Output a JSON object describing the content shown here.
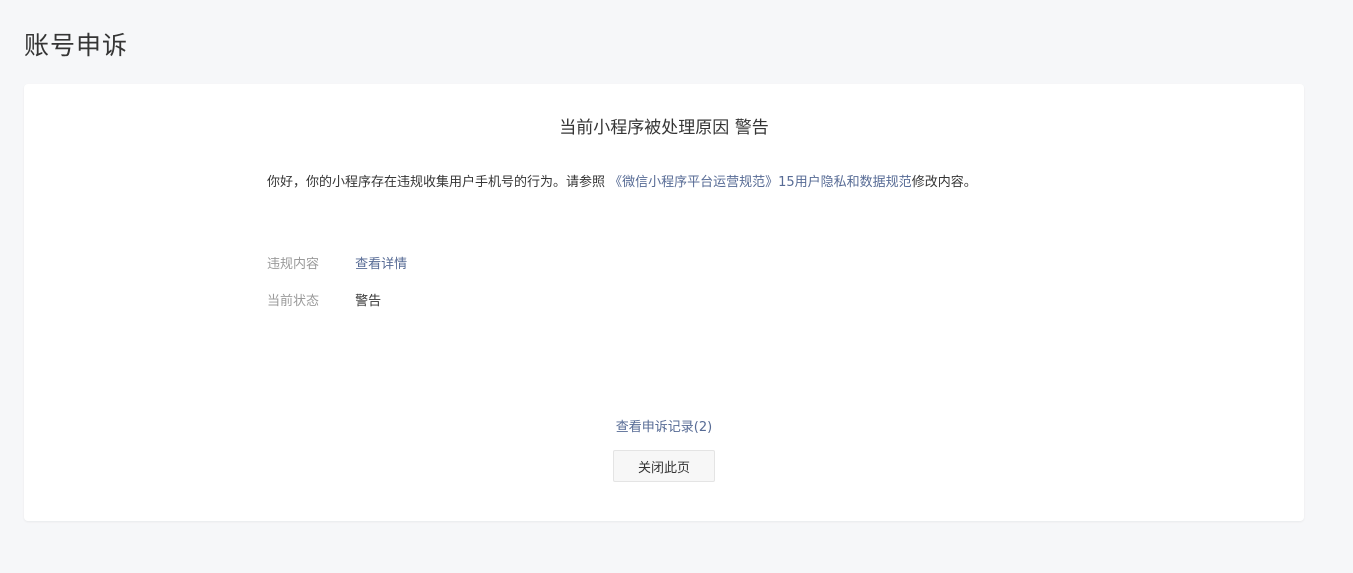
{
  "page": {
    "title": "账号申诉"
  },
  "card": {
    "reason_title": "当前小程序被处理原因 警告",
    "notice": {
      "text_before": "你好，你的小程序存在违规收集用户手机号的行为。请参照 ",
      "link_text": "《微信小程序平台运营规范》15用户隐私和数据规范",
      "text_after": "修改内容。"
    },
    "info": [
      {
        "label": "违规内容",
        "value": "查看详情"
      },
      {
        "label": "当前状态",
        "value": "警告"
      }
    ],
    "history_link": "查看申诉记录(2)",
    "close_button": "关闭此页"
  },
  "colors": {
    "link": "#576b95",
    "label": "#9a9a9a",
    "text": "#353535",
    "background": "#f6f7f9"
  }
}
